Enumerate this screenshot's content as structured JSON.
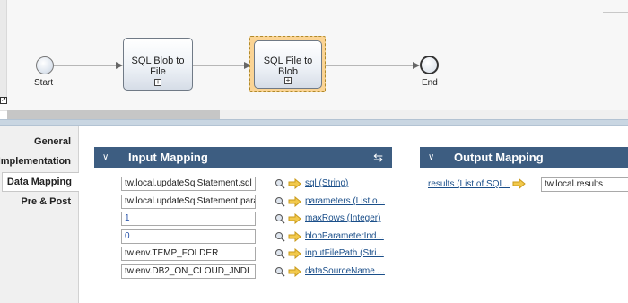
{
  "diagram": {
    "start_label": "Start",
    "end_label": "End",
    "tasks": [
      {
        "name": "SQL Blob to File",
        "line1": "SQL Blob to",
        "line2": "File",
        "marker": "+"
      },
      {
        "name": "SQL File to Blob",
        "line1": "SQL File to",
        "line2": "Blob",
        "marker": "+",
        "selected": true
      }
    ]
  },
  "properties": {
    "tabs": [
      {
        "label": "General",
        "active": false
      },
      {
        "label": "Implementation",
        "active": false
      },
      {
        "label": "Data Mapping",
        "active": true
      },
      {
        "label": "Pre & Post",
        "active": false
      }
    ],
    "input_mapping": {
      "title": "Input Mapping",
      "rows": [
        {
          "value": "tw.local.updateSqlStatement.sql",
          "param": "sql (String)"
        },
        {
          "value": "tw.local.updateSqlStatement.parameters",
          "param": "parameters (List o..."
        },
        {
          "value": "1",
          "param": "maxRows (Integer)"
        },
        {
          "value": "0",
          "param": "blobParameterInd..."
        },
        {
          "value": "tw.env.TEMP_FOLDER",
          "param": "inputFilePath (Stri..."
        },
        {
          "value": "tw.env.DB2_ON_CLOUD_JNDI",
          "param": "dataSourceName ..."
        }
      ]
    },
    "output_mapping": {
      "title": "Output Mapping",
      "rows": [
        {
          "param": "results (List of SQL...",
          "value": "tw.local.results"
        }
      ]
    }
  },
  "colors": {
    "section_header": "#3d5d81",
    "selected_task_fill": "#fbd494",
    "link": "#1b4f8a",
    "arrow": "#e0a81c"
  },
  "icons": {
    "chevron": "chevron-down-icon",
    "swap": "swap-arrows-icon",
    "variable": "variable-picker-icon",
    "mapping_arrow": "mapping-arrow-icon"
  }
}
